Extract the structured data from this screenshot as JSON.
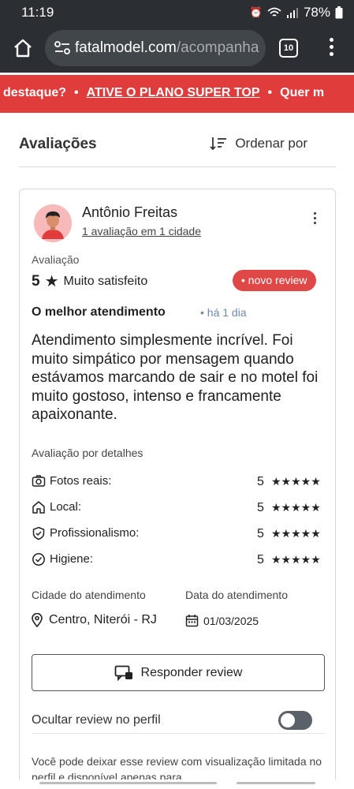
{
  "status_bar": {
    "time": "11:19",
    "battery": "78%"
  },
  "browser": {
    "url_host": "fatalmodel.com",
    "url_path": "/acompanha",
    "tab_count": "10"
  },
  "promo": {
    "lead": "destaque?",
    "sep": "•",
    "link": "ATIVE O PLANO SUPER TOP",
    "trail": "Quer m"
  },
  "header": {
    "title": "Avaliações",
    "sort_label": "Ordenar por"
  },
  "review": {
    "reviewer_name": "Antônio Freitas",
    "reviewer_meta": "1 avaliação em 1 cidade",
    "rating_label": "Avaliação",
    "rating_value": "5",
    "rating_star": "★",
    "rating_text": "Muito satisfeito",
    "badge": "• novo review",
    "title": "O melhor atendimento",
    "date": "• há 1 dia",
    "body": "Atendimento simplesmente incrível. Foi muito simpático por mensagem quando estávamos marcando de sair e no motel foi muito gostoso, intenso e francamente apaixonante.",
    "details_label": "Avaliação por detalhes",
    "details": [
      {
        "label": "Fotos reais:",
        "score": "5",
        "stars": "★★★★★",
        "icon": "camera-icon"
      },
      {
        "label": "Local:",
        "score": "5",
        "stars": "★★★★★",
        "icon": "home-icon"
      },
      {
        "label": "Profissionalismo:",
        "score": "5",
        "stars": "★★★★★",
        "icon": "shield-check-icon"
      },
      {
        "label": "Higiene:",
        "score": "5",
        "stars": "★★★★★",
        "icon": "check-circle-icon"
      }
    ],
    "city_label": "Cidade do atendimento",
    "city_value": "Centro, Niterói - RJ",
    "date_label": "Data do atendimento",
    "date_value": "01/03/2025",
    "reply_label": "Responder review",
    "hide_label": "Ocultar review no perfil",
    "hide_enabled": false,
    "info_text": "Você pode deixar esse review com visualização limitada no perfil e disponível apenas para"
  },
  "colors": {
    "accent": "#e03c3c",
    "browser_bg": "#2b2f33",
    "badge": "#e04848"
  }
}
